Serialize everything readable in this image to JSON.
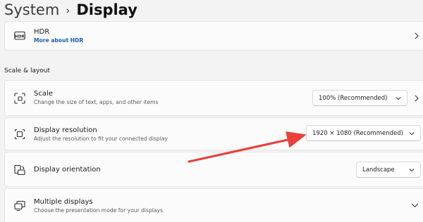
{
  "breadcrumb": {
    "parent": "System",
    "separator": "›",
    "current": "Display"
  },
  "hdr": {
    "icon_text": "HDR",
    "title": "HDR",
    "link": "More about HDR"
  },
  "section": {
    "title": "Scale & layout"
  },
  "scale": {
    "title": "Scale",
    "subtitle": "Change the size of text, apps, and other items",
    "value": "100% (Recommended)"
  },
  "resolution": {
    "title": "Display resolution",
    "subtitle": "Adjust the resolution to fit your connected display",
    "value": "1920 × 1080 (Recommended)"
  },
  "orientation": {
    "title": "Display orientation",
    "value": "Landscape"
  },
  "multiple": {
    "title": "Multiple displays",
    "subtitle": "Choose the presentation mode for your displays"
  },
  "colors": {
    "accent_link": "#1a5fb4",
    "annotation_arrow": "#e8413a"
  },
  "icons": {
    "hdr": "hdr-icon",
    "scale": "scale-icon",
    "resolution": "resolution-icon",
    "orientation": "orientation-icon",
    "multiple": "multiple-displays-icon"
  }
}
